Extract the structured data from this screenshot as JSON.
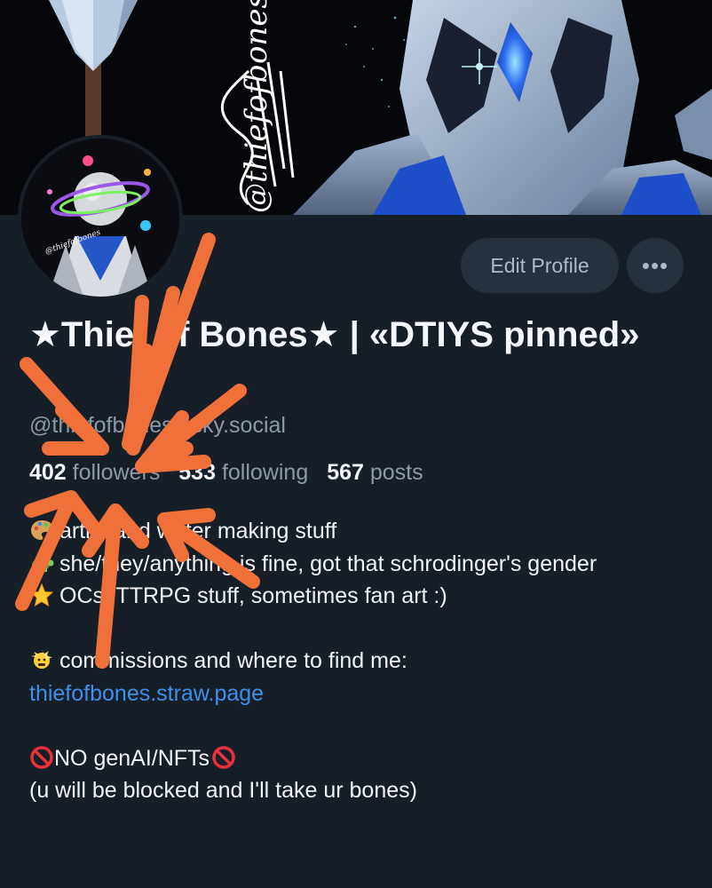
{
  "banner": {
    "signature": "@thiefofbones"
  },
  "profile": {
    "display_name": "★Thief of Bones★ | «DTIYS pinned»",
    "handle": "@thiefofbones.bsky.social",
    "followers_count": "402",
    "followers_label": "followers",
    "following_count": "533",
    "following_label": "following",
    "posts_count": "567",
    "posts_label": "posts"
  },
  "actions": {
    "edit_profile": "Edit Profile",
    "more": "•••"
  },
  "bio": {
    "line1": "artist and writer making stuff",
    "line1_icon": "palette-emoji",
    "line2": "she/they/anything is fine, got that schrodinger's gender",
    "line2_icon": "turtle-emoji",
    "line3": "OCs, TTRPG stuff, sometimes fan art :)",
    "line3_icon": "glowing-star-emoji",
    "line4": "commissions and where to find me:",
    "line4_icon": "explosion-emoji",
    "link": "thiefofbones.straw.page",
    "line5_left_icon": "prohibited-emoji",
    "line5": "NO genAI/NFTs",
    "line5_right_icon": "prohibited-emoji",
    "line6": "(u will be blocked and I'll take ur bones)"
  },
  "annotation": {
    "type": "hand-drawn orange arrows pointing at follower count",
    "color": "#f0703a"
  },
  "colors": {
    "background": "#161e27",
    "button": "#26313d",
    "link": "#3d8fe8",
    "muted": "#8d99a8"
  }
}
